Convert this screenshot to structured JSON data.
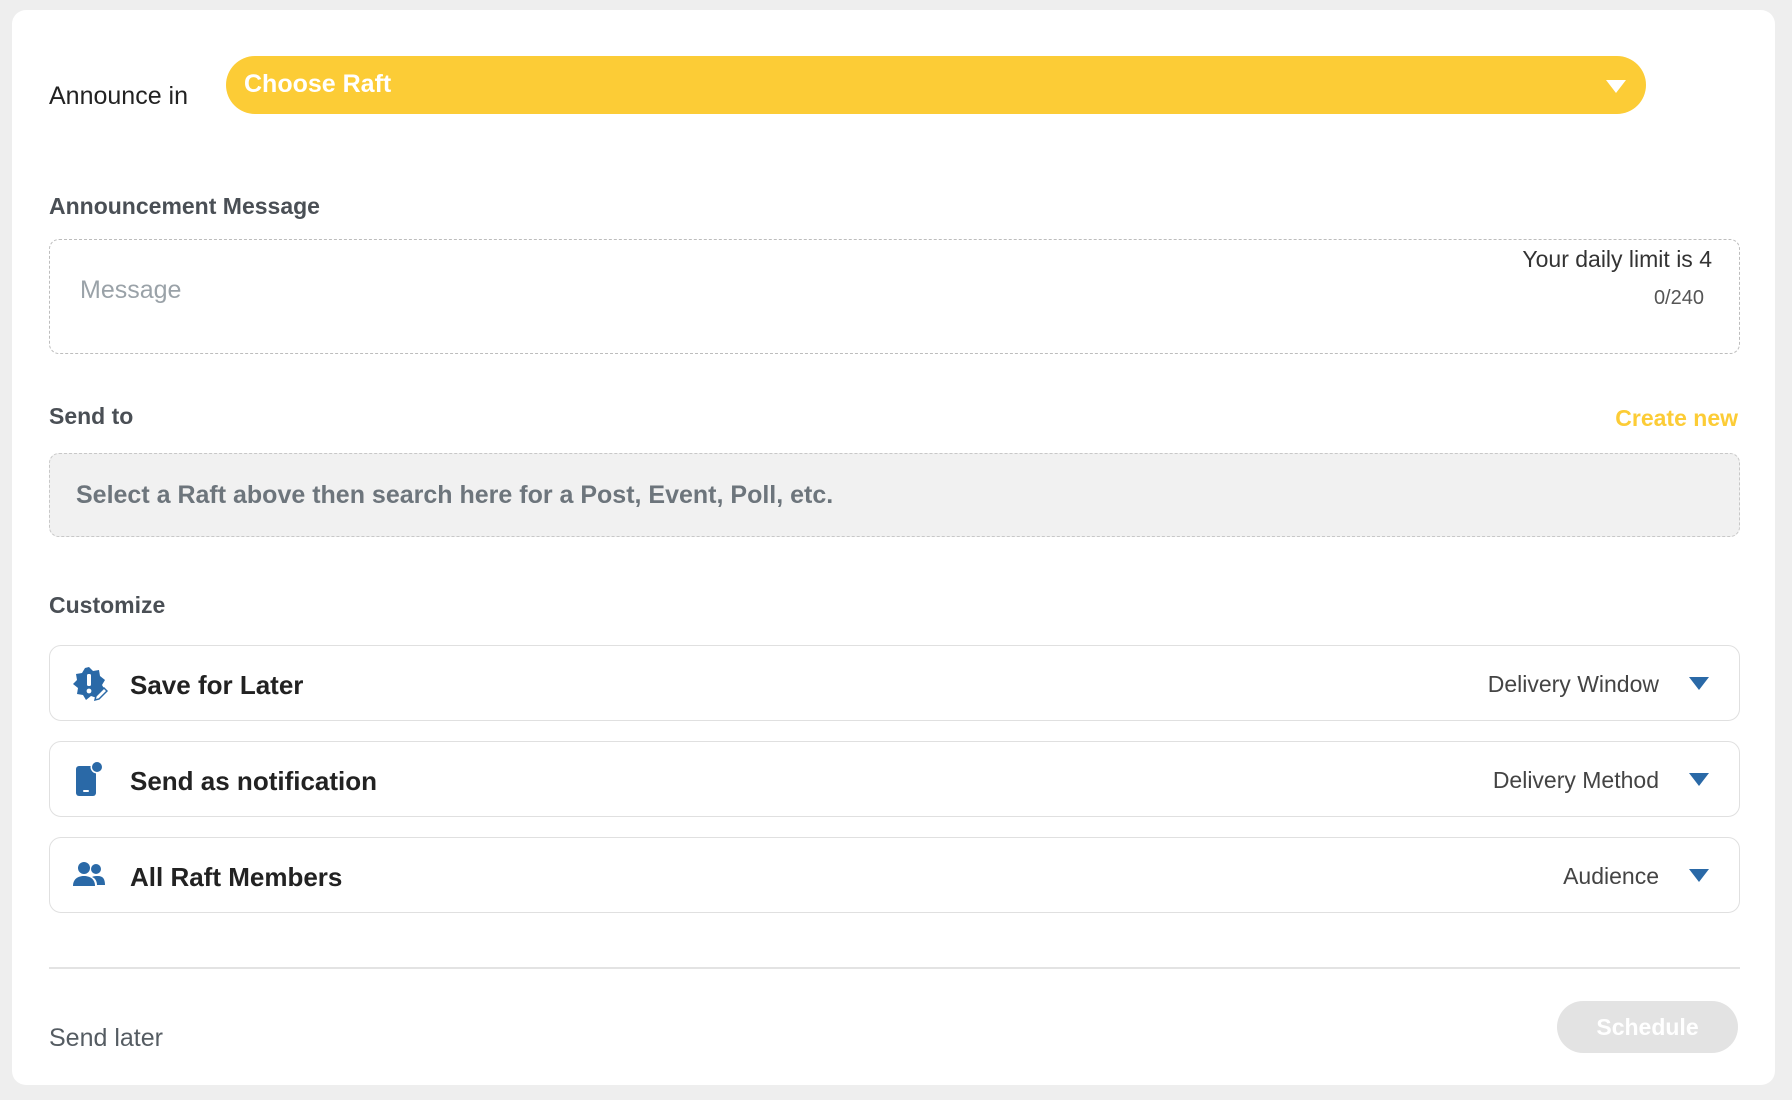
{
  "announce": {
    "label": "Announce in",
    "raft_select_label": "Choose Raft"
  },
  "message": {
    "section_title": "Announcement Message",
    "placeholder": "Message",
    "daily_limit": "Your daily limit is 4",
    "char_count": "0/240"
  },
  "send_to": {
    "section_title": "Send to",
    "create_new": "Create new",
    "search_placeholder": "Select a Raft above then search here for a Post, Event, Poll, etc."
  },
  "customize": {
    "section_title": "Customize",
    "options": [
      {
        "label": "Save for Later",
        "value": "Delivery Window",
        "icon": "badge-alert-icon"
      },
      {
        "label": "Send as notification",
        "value": "Delivery Method",
        "icon": "phone-notification-icon"
      },
      {
        "label": "All Raft Members",
        "value": "Audience",
        "icon": "people-icon"
      }
    ]
  },
  "footer": {
    "send_later": "Send later",
    "schedule": "Schedule"
  },
  "colors": {
    "accent_yellow": "#fccc36",
    "icon_blue": "#2a69a7",
    "disabled_button": "#e3e3e3"
  }
}
